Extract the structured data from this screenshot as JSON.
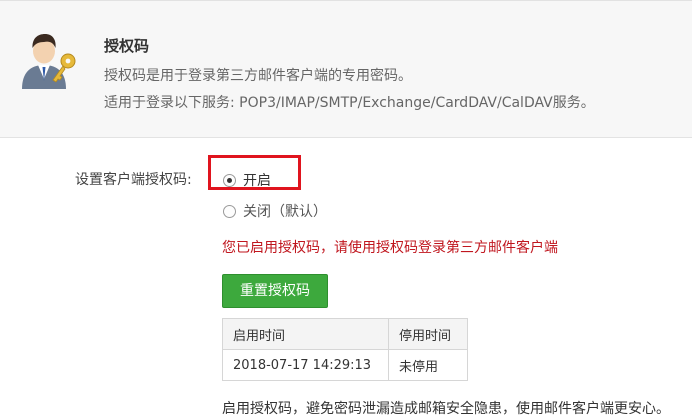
{
  "header": {
    "title": "授权码",
    "desc1": "授权码是用于登录第三方邮件客户端的专用密码。",
    "desc2": "适用于登录以下服务: POP3/IMAP/SMTP/Exchange/CardDAV/CalDAV服务。"
  },
  "setting": {
    "label": "设置客户端授权码:",
    "options": [
      {
        "label": "开启",
        "selected": true
      },
      {
        "label": "关闭（默认）",
        "selected": false
      }
    ]
  },
  "notice": "您已启用授权码，请使用授权码登录第三方邮件客户端",
  "reset_button": "重置授权码",
  "table": {
    "headers": [
      "启用时间",
      "停用时间"
    ],
    "rows": [
      [
        "2018-07-17 14:29:13",
        "未停用"
      ]
    ]
  },
  "footer_text": "启用授权码，避免密码泄漏造成邮箱安全隐患，使用邮件客户端更安心。",
  "colors": {
    "accent_green": "#3da93d",
    "notice_red": "#c0161e",
    "highlight_red": "#e0141e"
  },
  "icons": {
    "avatar": "user-key-avatar-icon"
  }
}
